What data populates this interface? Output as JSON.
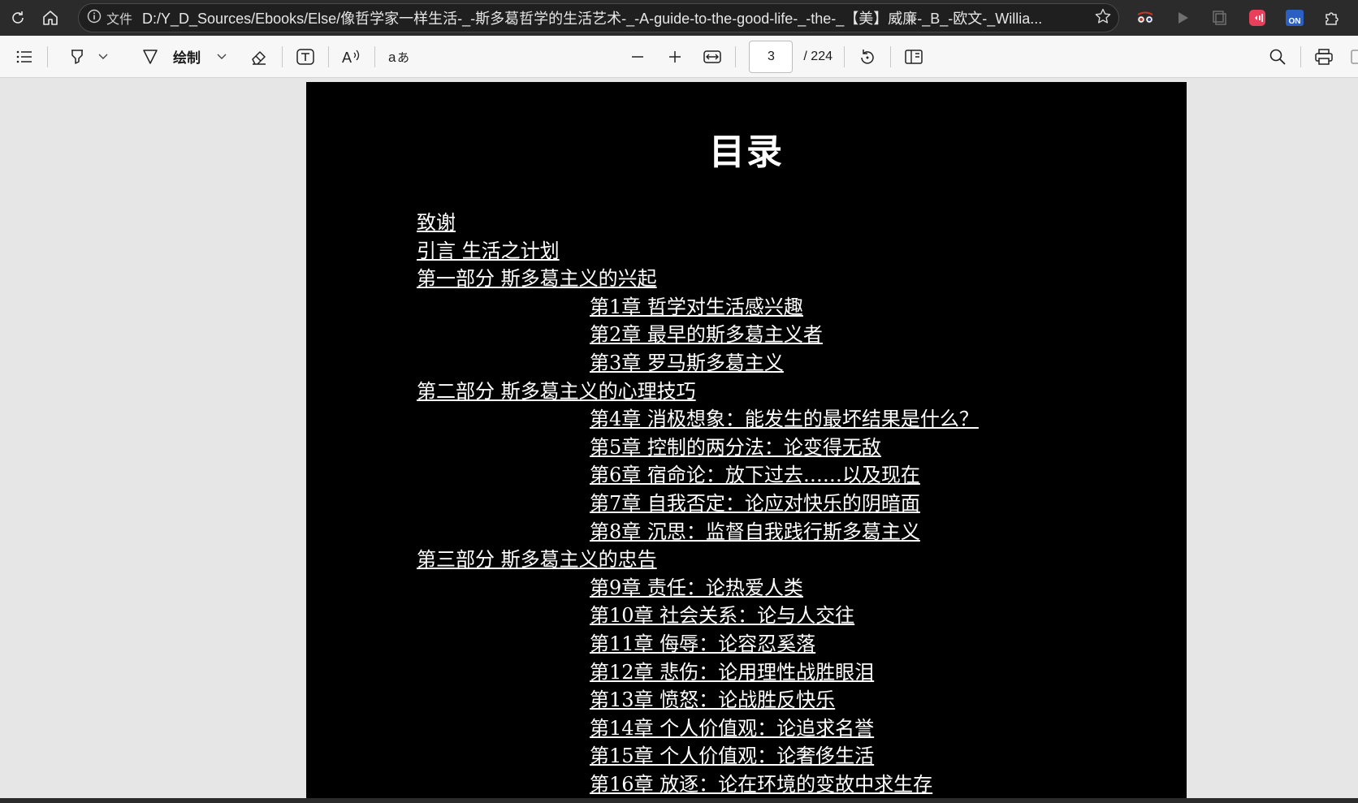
{
  "browser": {
    "scheme_label": "文件",
    "url": "D:/Y_D_Sources/Ebooks/Else/像哲学家一样生活-_-斯多葛哲学的生活艺术-_-A-guide-to-the-good-life-_-the-_【美】威廉-_B_-欧文-_Willia...",
    "ext_badge": "ON"
  },
  "toolbar": {
    "draw_label": "绘制",
    "page_current": "3",
    "page_total": "/ 224",
    "icons": [
      "contents-icon",
      "highlight-icon",
      "draw-icon",
      "eraser-icon",
      "text-box-icon",
      "read-aloud-icon",
      "translate-icon",
      "zoom-out-icon",
      "zoom-in-icon",
      "fit-width-icon",
      "rotate-icon",
      "page-view-icon",
      "search-icon",
      "print-icon"
    ]
  },
  "document": {
    "title": "目录",
    "toc": [
      {
        "level": 1,
        "label": "致谢"
      },
      {
        "level": 1,
        "label": "引言 生活之计划"
      },
      {
        "level": 1,
        "label": "第一部分 斯多葛主义的兴起"
      },
      {
        "level": 2,
        "label": "第1章 哲学对生活感兴趣"
      },
      {
        "level": 2,
        "label": "第2章 最早的斯多葛主义者"
      },
      {
        "level": 2,
        "label": "第3章 罗马斯多葛主义"
      },
      {
        "level": 1,
        "label": "第二部分 斯多葛主义的心理技巧"
      },
      {
        "level": 2,
        "label": "第4章 消极想象：能发生的最坏结果是什么？"
      },
      {
        "level": 2,
        "label": "第5章 控制的两分法：论变得无敌"
      },
      {
        "level": 2,
        "label": "第6章 宿命论：放下过去……以及现在"
      },
      {
        "level": 2,
        "label": "第7章 自我否定：论应对快乐的阴暗面"
      },
      {
        "level": 2,
        "label": "第8章 沉思：监督自我践行斯多葛主义"
      },
      {
        "level": 1,
        "label": "第三部分 斯多葛主义的忠告"
      },
      {
        "level": 2,
        "label": "第9章 责任：论热爱人类"
      },
      {
        "level": 2,
        "label": "第10章 社会关系：论与人交往"
      },
      {
        "level": 2,
        "label": "第11章 侮辱：论容忍奚落"
      },
      {
        "level": 2,
        "label": "第12章 悲伤：论用理性战胜眼泪"
      },
      {
        "level": 2,
        "label": "第13章 愤怒：论战胜反快乐"
      },
      {
        "level": 2,
        "label": "第14章 个人价值观：论追求名誉"
      },
      {
        "level": 2,
        "label": "第15章 个人价值观：论奢侈生活"
      },
      {
        "level": 2,
        "label": "第16章 放逐：论在环境的变故中求生存"
      }
    ]
  }
}
